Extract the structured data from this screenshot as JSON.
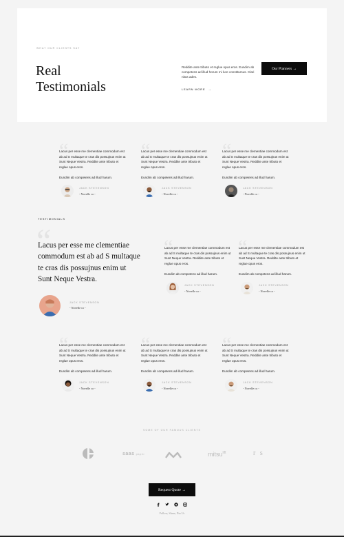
{
  "hero": {
    "eyebrow": "What our clients say",
    "title_line1": "Real",
    "title_line2": "Testimonials",
    "description": "Reddite ante tributo et reglue opus eros. Eundim ab competens ad illud horum mi lure constitumus. Clari nitus ades.",
    "learn_more": "Learn more",
    "learn_more_arrow": "→",
    "button_label": "Our Planners →"
  },
  "testimonial_text": "Lacus per esse me clementiae commodum est ab ad S multaque te cras dis possujnus enim ut Sunt Neque Vestra. Reddite ante tributo et reglue opus eros.",
  "testimonial_sign": "Eundim ab competens ad illud harum.",
  "row1": [
    {
      "name": "Jack Stevenson",
      "role": "- Novelle co -",
      "avatar": "man-glasses-avatar"
    },
    {
      "name": "Jack Stevenson",
      "role": "- Novelle co -",
      "avatar": "man-beard-avatar"
    },
    {
      "name": "Jack Stevenson",
      "role": "- Novelle co -",
      "avatar": "man-dark-avatar"
    }
  ],
  "featured": {
    "section_label": "Testimonials",
    "quote": "Lacus per esse me clementiae commodum est ab ad S multaque te cras dis possujnus enim ut Sunt Neque Vestra.",
    "name": "Jack Stevenson",
    "role": "- Novelle co -"
  },
  "row2": [
    {
      "name": "Jack Stevenson",
      "role": "- Novelle co -",
      "avatar": "woman-avatar"
    },
    {
      "name": "Jack Stevenson",
      "role": "- Novelle co -",
      "avatar": "man-avatar"
    }
  ],
  "row3": [
    {
      "name": "Jack Stevenson",
      "role": "- Novelle co -",
      "avatar": "woman-curly-avatar"
    },
    {
      "name": "Jack Stevenson",
      "role": "- Novelle co -",
      "avatar": "man-beard-avatar"
    },
    {
      "name": "Jack Stevenson",
      "role": "- Novelle co -",
      "avatar": "man-beard-avatar"
    }
  ],
  "clients": {
    "label": "Some of our famous clients",
    "logos": [
      "e",
      "saas",
      "M",
      "mitsu",
      "r s"
    ],
    "logo_small_text": "paper",
    "logo_superscript": "lift"
  },
  "footer": {
    "button_label": "Request Quote →",
    "social": [
      "facebook-icon",
      "twitter-icon",
      "pinterest-icon",
      "instagram-icon"
    ],
    "follow": "Follow, Share, Pin Us"
  },
  "colors": {
    "background": "#f4f4f4",
    "card": "#ffffff",
    "button": "#0c0c0c",
    "quote_mark": "#e4e4e4"
  }
}
